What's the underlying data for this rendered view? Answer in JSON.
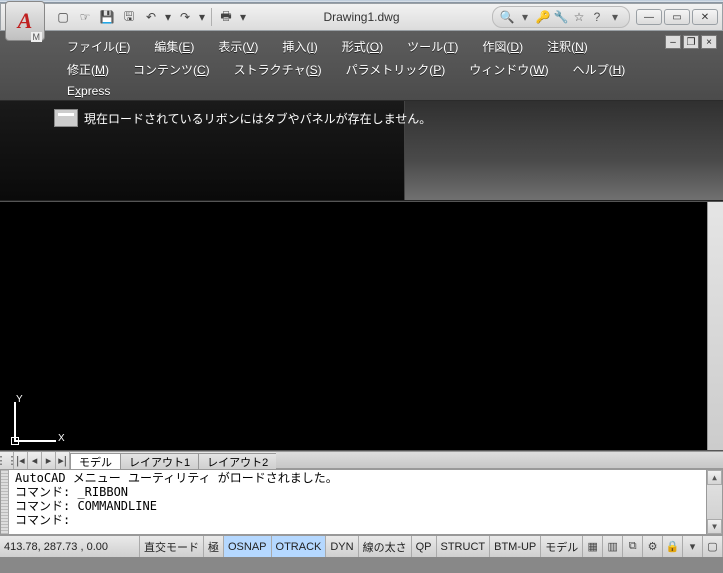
{
  "title": "Drawing1.dwg",
  "qat": {
    "new": "new",
    "open": "open",
    "save": "save",
    "save_as": "saveas",
    "undo": "undo",
    "redo": "redo",
    "print": "print"
  },
  "info_center": {
    "search": "search",
    "key": "key",
    "tool": "tool",
    "star": "star",
    "help": "help"
  },
  "menu": {
    "row1": [
      {
        "label": "ファイル",
        "u": "F"
      },
      {
        "label": "編集",
        "u": "E"
      },
      {
        "label": "表示",
        "u": "V"
      },
      {
        "label": "挿入",
        "u": "I"
      },
      {
        "label": "形式",
        "u": "O"
      },
      {
        "label": "ツール",
        "u": "T"
      },
      {
        "label": "作図",
        "u": "D"
      },
      {
        "label": "注釈",
        "u": "N"
      }
    ],
    "row2": [
      {
        "label": "修正",
        "u": "M"
      },
      {
        "label": "コンテンツ",
        "u": "C"
      },
      {
        "label": "ストラクチャ",
        "u": "S"
      },
      {
        "label": "パラメトリック",
        "u": "P"
      },
      {
        "label": "ウィンドウ",
        "u": "W"
      },
      {
        "label": "ヘルプ",
        "u": "H"
      }
    ],
    "row3": [
      {
        "label": "E",
        "u": "x",
        "suffix": "press"
      }
    ]
  },
  "ribbon_message": "現在ロードされているリボンにはタブやパネルが存在しません。",
  "ucs": {
    "y_label": "Y",
    "x_label": "X"
  },
  "tabs": {
    "model": "モデル",
    "layout1": "レイアウト1",
    "layout2": "レイアウト2"
  },
  "command_lines": [
    "AutoCAD メニュー ユーティリティ がロードされました。",
    "コマンド: _RIBBON",
    "コマンド: COMMANDLINE",
    "コマンド:"
  ],
  "status": {
    "coords": "413.78, 287.73 , 0.00",
    "ortho": "直交モード",
    "polar": "極",
    "osnap": "OSNAP",
    "otrack": "OTRACK",
    "dyn": "DYN",
    "lwt": "線の太さ",
    "qp": "QP",
    "struct": "STRUCT",
    "btm": "BTM-UP",
    "model": "モデル"
  }
}
